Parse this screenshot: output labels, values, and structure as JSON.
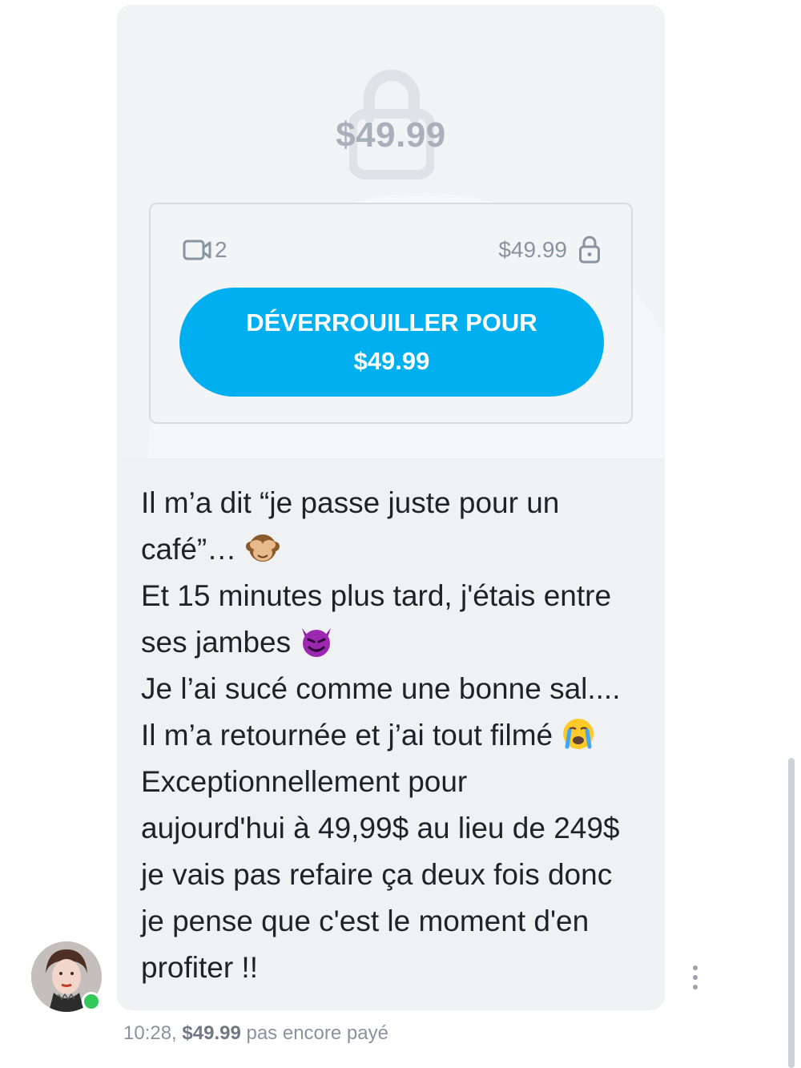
{
  "media": {
    "price_overlay": "$49.99",
    "item_count": "2",
    "price": "$49.99",
    "unlock_button": {
      "line1": "DÉVERROUILLER POUR",
      "line2": "$49.99"
    },
    "icons": [
      "lock-icon",
      "video-icon"
    ]
  },
  "message": {
    "lines": [
      "Il m’a dit “je passe juste pour un",
      "café”… ",
      "Et 15 minutes plus tard, j'étais entre",
      "ses jambes ",
      "Je l’ai sucé comme une bonne sal....",
      "Il m’a retournée et j’ai tout filmé ",
      "Exceptionnellement pour",
      "aujourd'hui à 49,99$ au lieu de 249$",
      "je vais pas refaire ça deux fois donc",
      "je pense que c'est le moment d'en",
      "profiter !!"
    ],
    "emojis": [
      "see-no-evil-monkey",
      "smiling-devil",
      "crying-face"
    ]
  },
  "footer": {
    "time": "10:28,",
    "price": "$49.99",
    "status": "pas encore payé"
  },
  "colors": {
    "accent": "#00aff0",
    "online": "#34c759",
    "muted": "#8a93a0"
  }
}
